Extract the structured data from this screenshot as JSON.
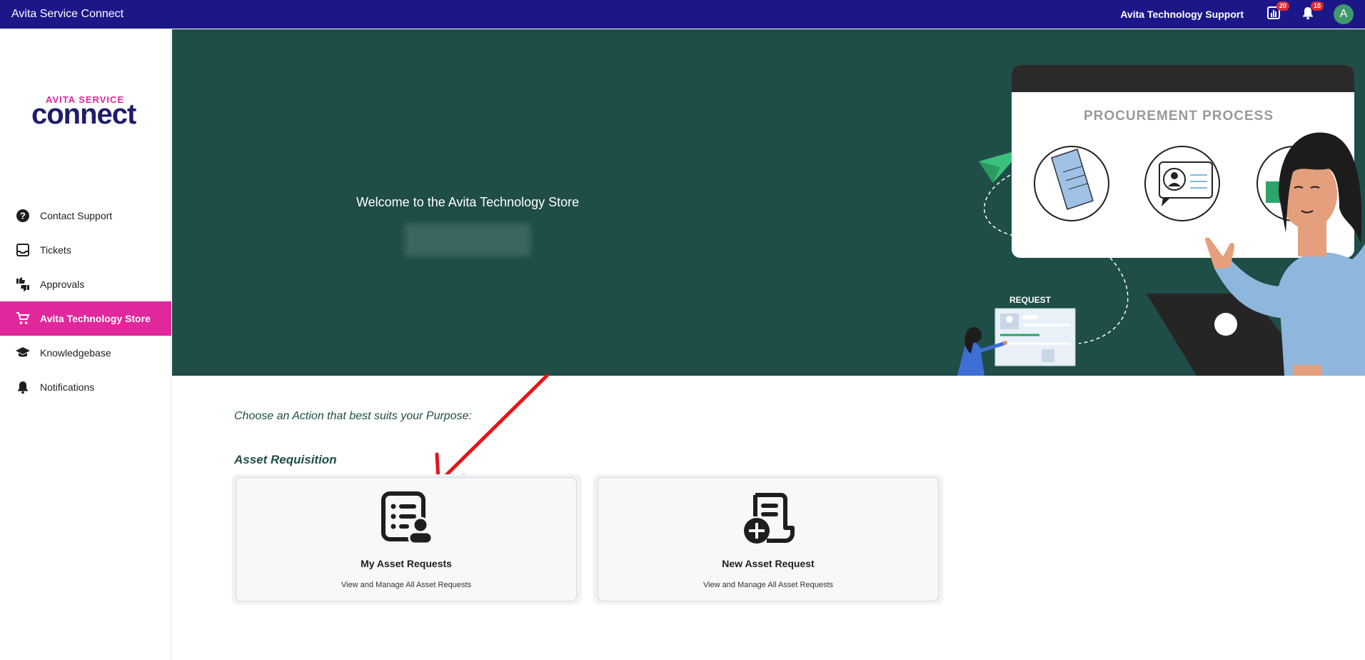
{
  "topbar": {
    "app_title": "Avita Service Connect",
    "user_name": "Avita Technology Support",
    "reports_badge": "20",
    "notifications_badge": "15",
    "avatar_initial": "A"
  },
  "logo": {
    "top": "AVITA SERVICE",
    "main": "connect"
  },
  "sidebar": {
    "items": [
      {
        "label": "Contact Support",
        "icon": "help-icon"
      },
      {
        "label": "Tickets",
        "icon": "inbox-icon"
      },
      {
        "label": "Approvals",
        "icon": "thumbs-icon"
      },
      {
        "label": "Avita Technology Store",
        "icon": "cart-icon",
        "active": true
      },
      {
        "label": "Knowledgebase",
        "icon": "graduation-cap-icon"
      },
      {
        "label": "Notifications",
        "icon": "bell-icon"
      }
    ]
  },
  "hero": {
    "welcome": "Welcome to the Avita Technology Store",
    "board_title": "PROCUREMENT PROCESS",
    "request_label": "REQUEST"
  },
  "content": {
    "intro": "Choose an Action that best suits your Purpose:",
    "section": "Asset Requisition",
    "cards": [
      {
        "title": "My Asset Requests",
        "desc": "View and Manage All Asset Requests",
        "icon": "list-user-icon"
      },
      {
        "title": "New Asset Request",
        "desc": "View and Manage All Asset Requests",
        "icon": "document-add-icon"
      }
    ]
  },
  "colors": {
    "topbar": "#1b1789",
    "accent": "#e0279b",
    "hero": "#1f4d47",
    "badge": "#e0292f",
    "arrow": "#e3161b"
  }
}
